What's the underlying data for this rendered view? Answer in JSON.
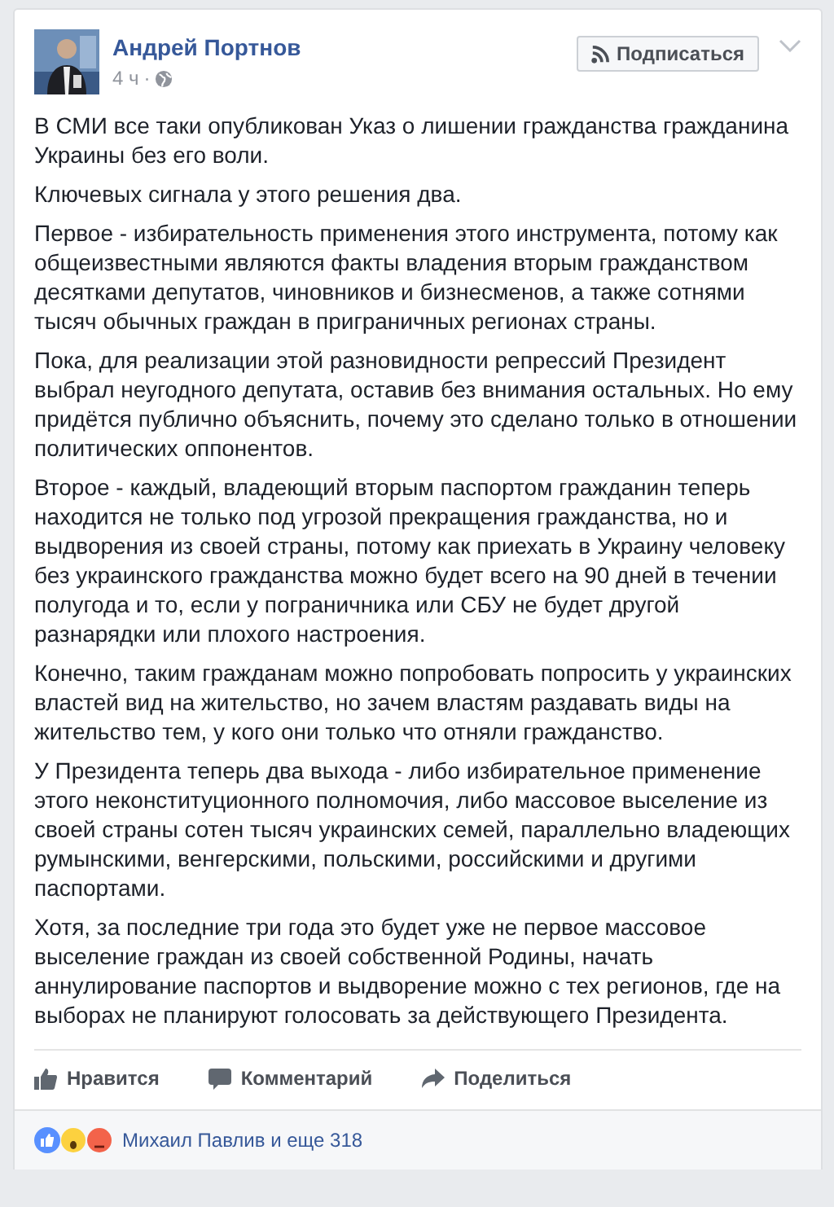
{
  "post": {
    "author": "Андрей Портнов",
    "time": "4 ч",
    "separator": "·",
    "follow_button": "Подписаться",
    "paragraphs": [
      "В СМИ все таки опубликован Указ о лишении гражданства гражданина Украины без его воли.",
      "Ключевых сигнала у этого решения два.",
      "Первое - избирательность применения этого инструмента, потому как общеизвестными являются факты владения вторым гражданством десятками депутатов, чиновников и бизнесменов, а также сотнями тысяч обычных граждан в приграничных регионах страны.",
      "Пока, для реализации этой разновидности репрессий Президент выбрал неугодного депутата, оставив без внимания остальных. Но ему придётся публично объяснить, почему это сделано только в отношении политических оппонентов.",
      "Второе - каждый, владеющий вторым паспортом гражданин теперь находится не только под угрозой прекращения гражданства, но и выдворения из своей страны, потому как приехать в Украину человеку без украинского гражданства можно будет всего на 90 дней в течении полугода и то, если у пограничника или СБУ не будет другой разнарядки или плохого настроения.",
      "Конечно, таким гражданам можно попробовать попросить у украинских властей вид на жительство, но зачем властям раздавать виды на жительство тем, у кого они только что отняли гражданство.",
      "У Президента теперь два выхода - либо избирательное применение этого неконституционного полномочия, либо массовое выселение из своей страны сотен тысяч украинских семей, параллельно владеющих румынскими, венгерскими, польскими, российскими и другими паспортами.",
      "Хотя, за последние три года это будет уже не первое массовое выселение граждан из своей собственной Родины, начать аннулирование паспортов и выдворение можно с тех регионов, где на выборах не планируют голосовать за действующего Президента."
    ],
    "actions": [
      {
        "kind": "like",
        "label": "Нравится"
      },
      {
        "kind": "comment",
        "label": "Комментарий"
      },
      {
        "kind": "share",
        "label": "Поделиться"
      }
    ],
    "reactions": {
      "summary": "Михаил Павлив и еще 318"
    }
  }
}
